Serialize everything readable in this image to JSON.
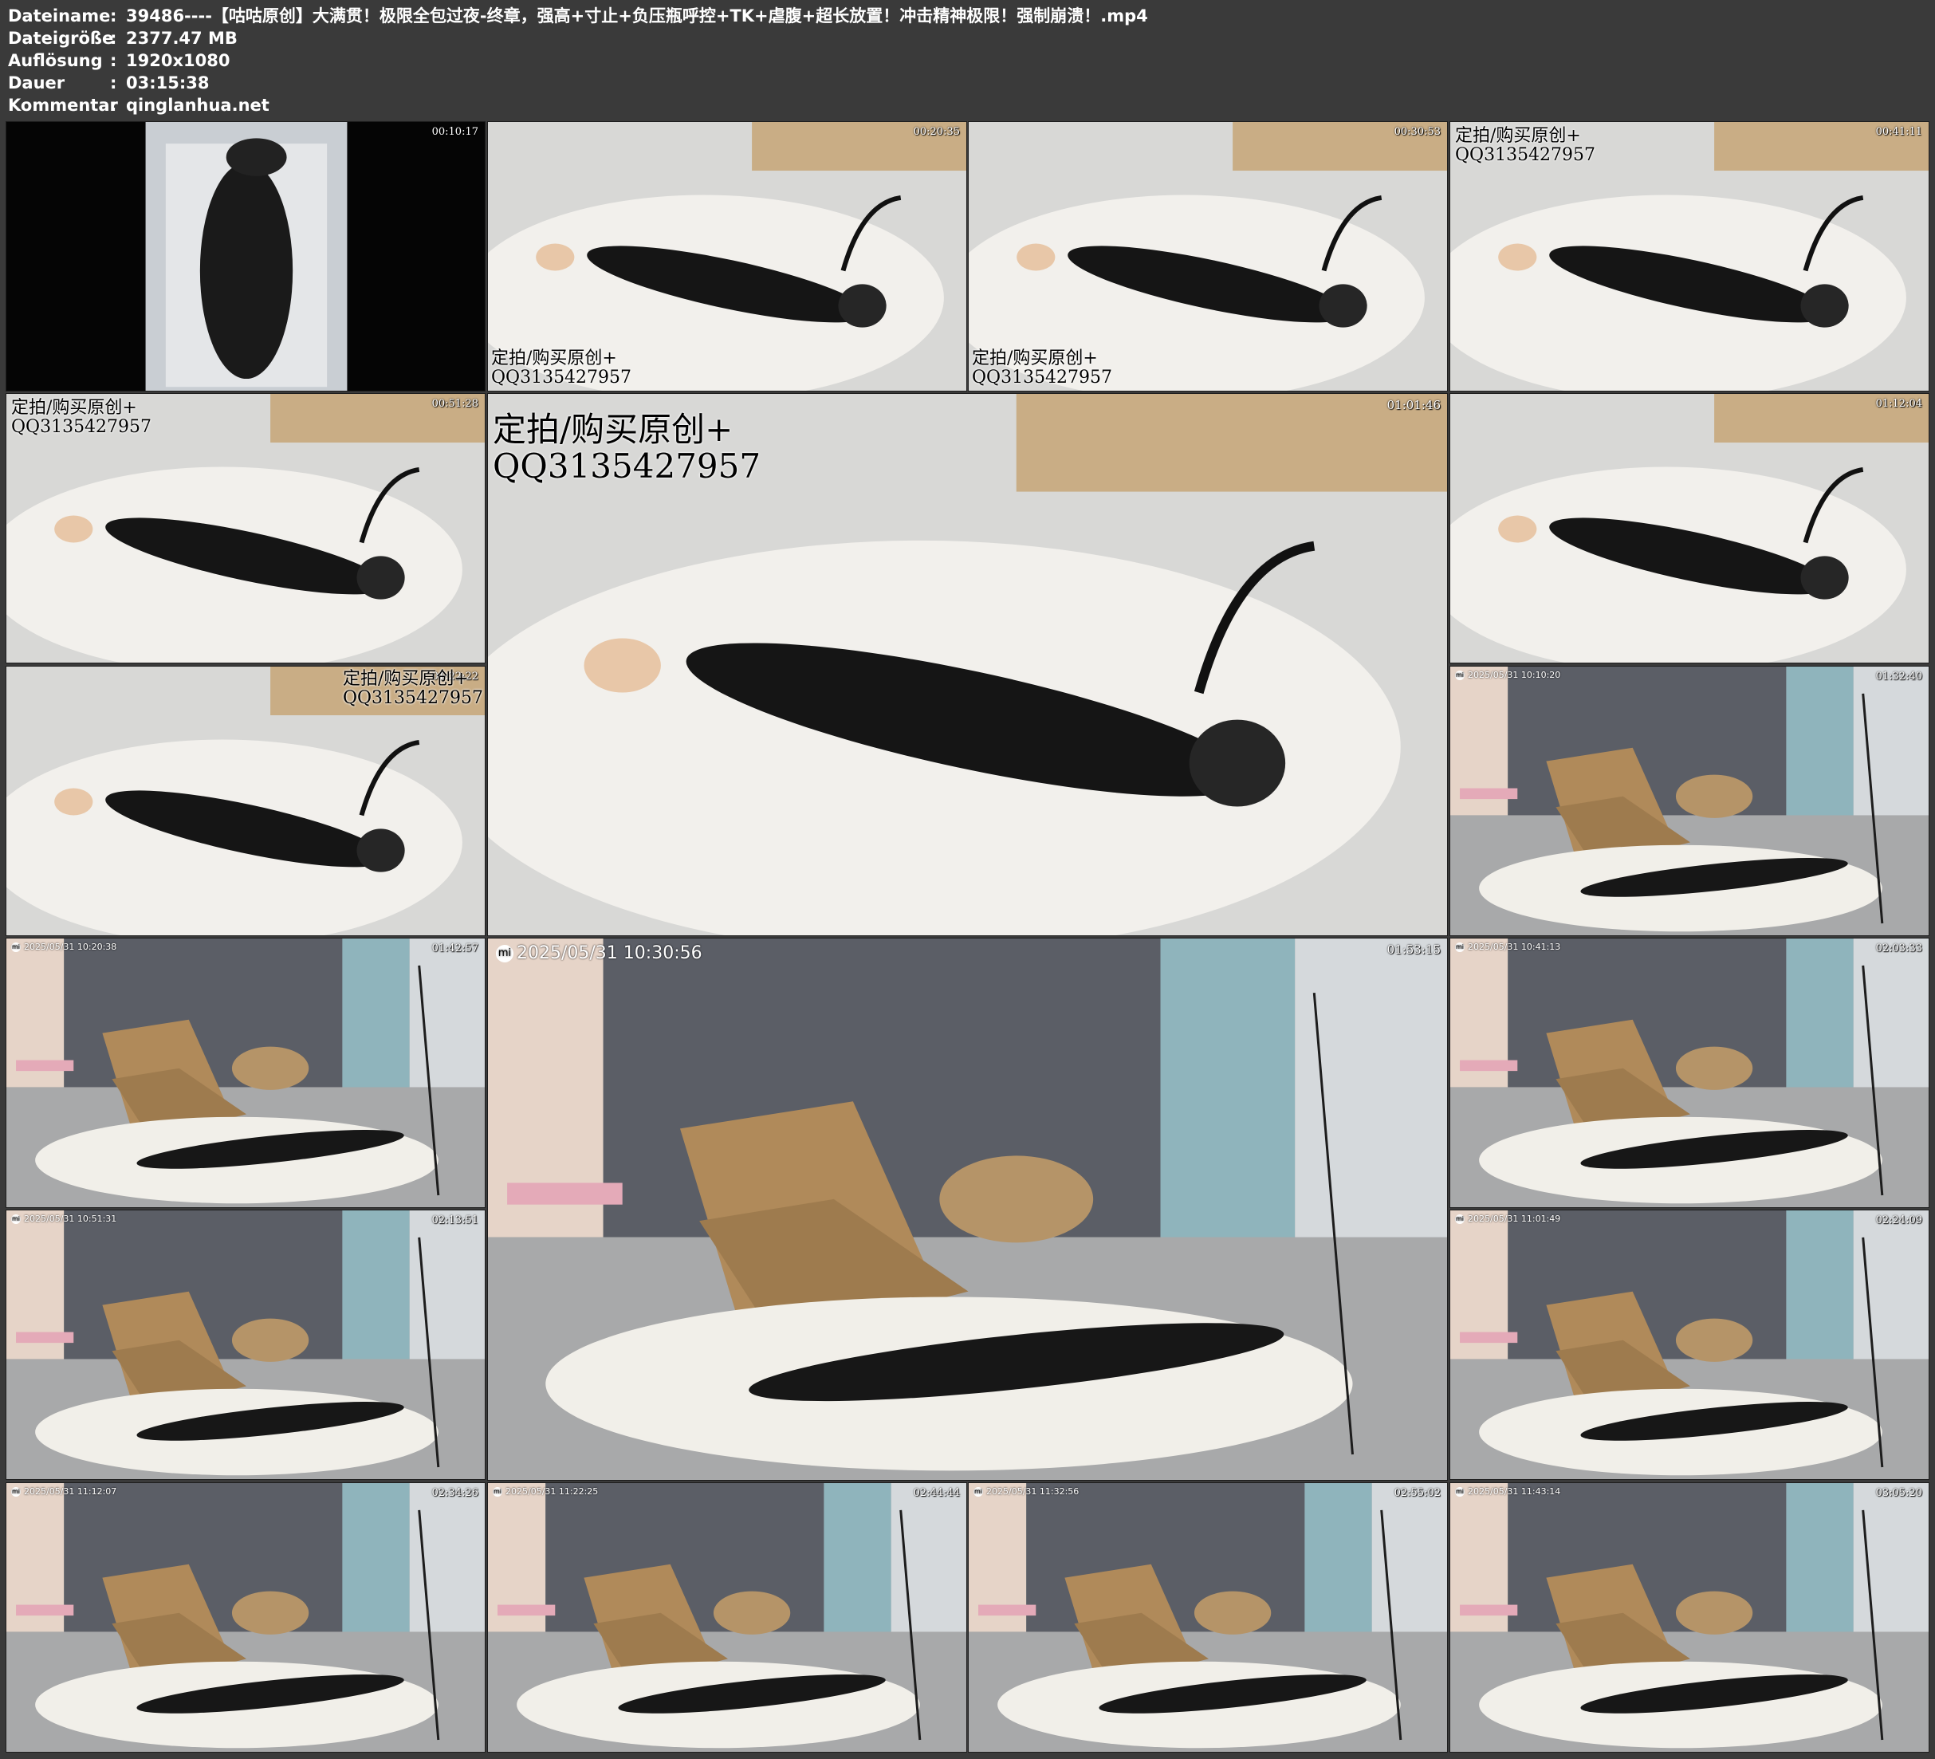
{
  "info": [
    {
      "label": "Dateiname",
      "value": "39486----【咕咕原创】大满贯！极限全包过夜-终章，强高+寸止+负压瓶呼控+TK+虐腹+超长放置！冲击精神极限！强制崩溃！.mp4"
    },
    {
      "label": "Dateigröße",
      "value": "2377.47 MB"
    },
    {
      "label": "Auflösung",
      "value": "1920x1080"
    },
    {
      "label": "Dauer",
      "value": "03:15:38"
    },
    {
      "label": "Kommentar",
      "value": "qinglanhua.net"
    }
  ],
  "separator": ":",
  "watermark": {
    "line1": "定拍/购买原创+",
    "line2": "QQ3135427957"
  },
  "thumbs": [
    {
      "time": "00:10:17",
      "scene": "bright",
      "portrait": true
    },
    {
      "time": "00:20:35",
      "scene": "bright",
      "wm": "bl"
    },
    {
      "time": "00:30:53",
      "scene": "bright",
      "wm": "bl"
    },
    {
      "time": "00:41:11",
      "scene": "bright",
      "wm": "tl"
    },
    {
      "time": "00:51:28",
      "scene": "bright",
      "wm": "tl"
    },
    {
      "time": "01:01:46",
      "scene": "bright",
      "wm": "tl",
      "big": true
    },
    {
      "time": "01:12:04",
      "scene": "bright"
    },
    {
      "time": "01:22:22",
      "scene": "bright",
      "wm": "tr"
    },
    {
      "time": "01:32:40",
      "scene": "room",
      "cam": "2025/05/31 10:10:20"
    },
    {
      "time": "01:42:57",
      "scene": "room",
      "cam": "2025/05/31 10:20:38"
    },
    {
      "time": "01:53:15",
      "scene": "room",
      "cam": "2025/05/31 10:30:56",
      "big": true
    },
    {
      "time": "02:03:33",
      "scene": "room",
      "cam": "2025/05/31 10:41:13"
    },
    {
      "time": "02:13:51",
      "scene": "room",
      "cam": "2025/05/31 10:51:31"
    },
    {
      "time": "02:24:09",
      "scene": "room",
      "cam": "2025/05/31 11:01:49"
    },
    {
      "time": "02:34:26",
      "scene": "room",
      "cam": "2025/05/31 11:12:07"
    },
    {
      "time": "02:44:44",
      "scene": "room",
      "cam": "2025/05/31 11:22:25"
    },
    {
      "time": "02:55:02",
      "scene": "room",
      "cam": "2025/05/31 11:32:56"
    },
    {
      "time": "03:05:20",
      "scene": "room",
      "cam": "2025/05/31 11:43:14"
    }
  ]
}
